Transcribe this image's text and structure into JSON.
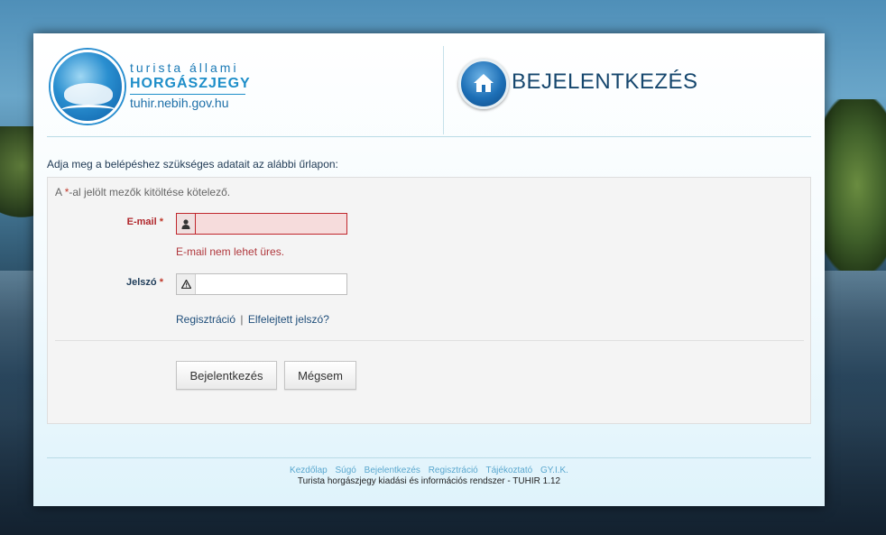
{
  "logo": {
    "line1": "turista állami",
    "line2": "HORGÁSZJEGY",
    "line3": "tuhir.nebih.gov.hu"
  },
  "header": {
    "title": "BEJELENTKEZÉS",
    "icon": "home-icon"
  },
  "intro": "Adja meg a belépéshez szükséges adatait az alábbi űrlapon:",
  "required_note": {
    "prefix": "A ",
    "star": "*",
    "suffix": "-al jelölt mezők kitöltése kötelező."
  },
  "form": {
    "email": {
      "label": "E-mail",
      "star": "*",
      "value": "",
      "error": "E-mail nem lehet üres.",
      "icon": "user-icon"
    },
    "password": {
      "label": "Jelszó",
      "star": "*",
      "value": "",
      "icon": "warning-icon"
    },
    "links": {
      "register": "Regisztráció",
      "separator": "|",
      "forgot": "Elfelejtett jelszó?"
    },
    "buttons": {
      "login": "Bejelentkezés",
      "cancel": "Mégsem"
    }
  },
  "footer": {
    "links": [
      "Kezdőlap",
      "Súgó",
      "Bejelentkezés",
      "Regisztráció",
      "Tájékoztató",
      "GY.I.K."
    ],
    "text": "Turista horgászjegy kiadási és információs rendszer - TUHIR 1.12"
  },
  "colors": {
    "accent": "#1e8ec9",
    "error": "#c0272d",
    "title": "#16476e"
  }
}
